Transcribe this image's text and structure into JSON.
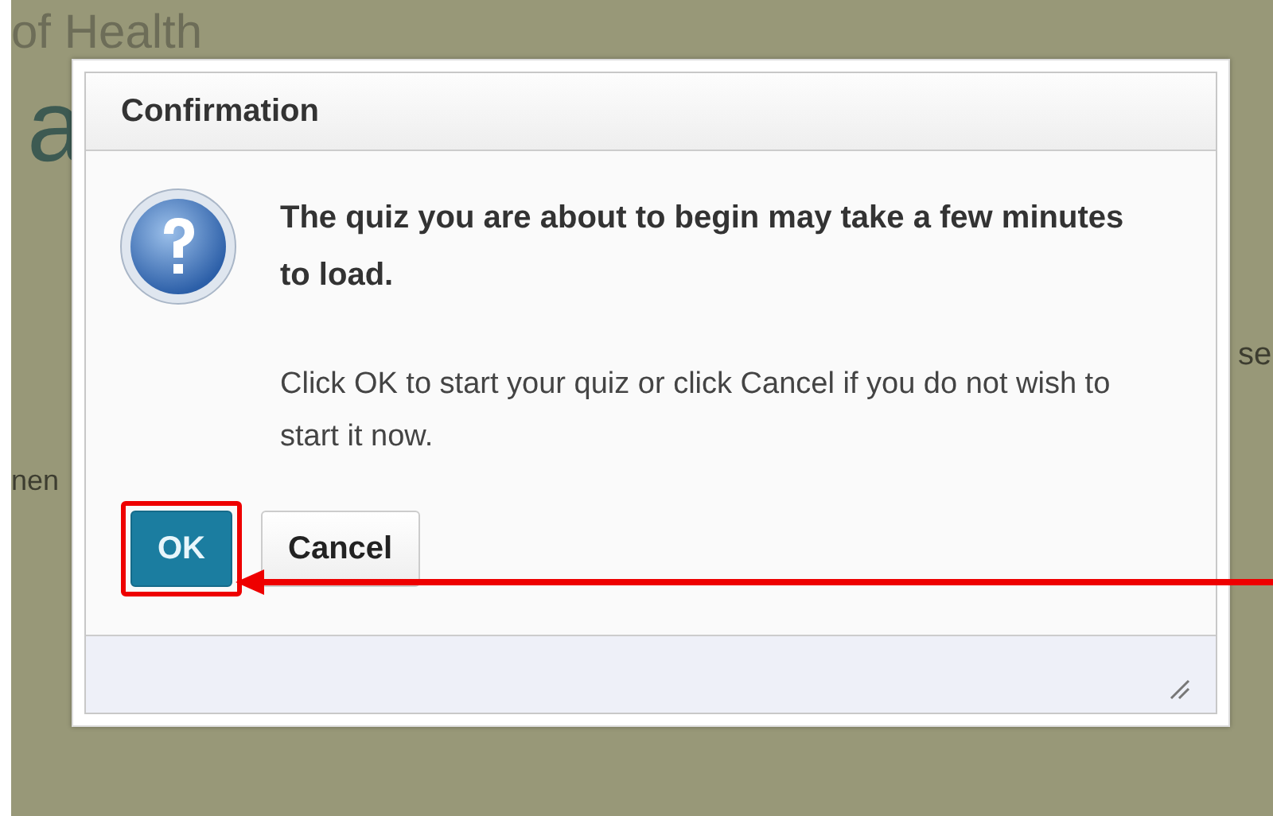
{
  "background_texts": [
    {
      "kind": "heading",
      "text": "of Health"
    },
    {
      "kind": "big",
      "text": "a"
    },
    {
      "kind": "right",
      "text": "se"
    },
    {
      "kind": "left",
      "text": "nen"
    }
  ],
  "dialog": {
    "title": "Confirmation",
    "message": "The quiz you are about to begin may take a few minutes to load.",
    "detail": "Click OK to start your quiz or click Cancel if you do not wish to start it now.",
    "buttons": [
      {
        "label": "OK",
        "primary": true,
        "highlighted": true
      },
      {
        "label": "Cancel",
        "primary": false,
        "highlighted": false
      }
    ]
  }
}
